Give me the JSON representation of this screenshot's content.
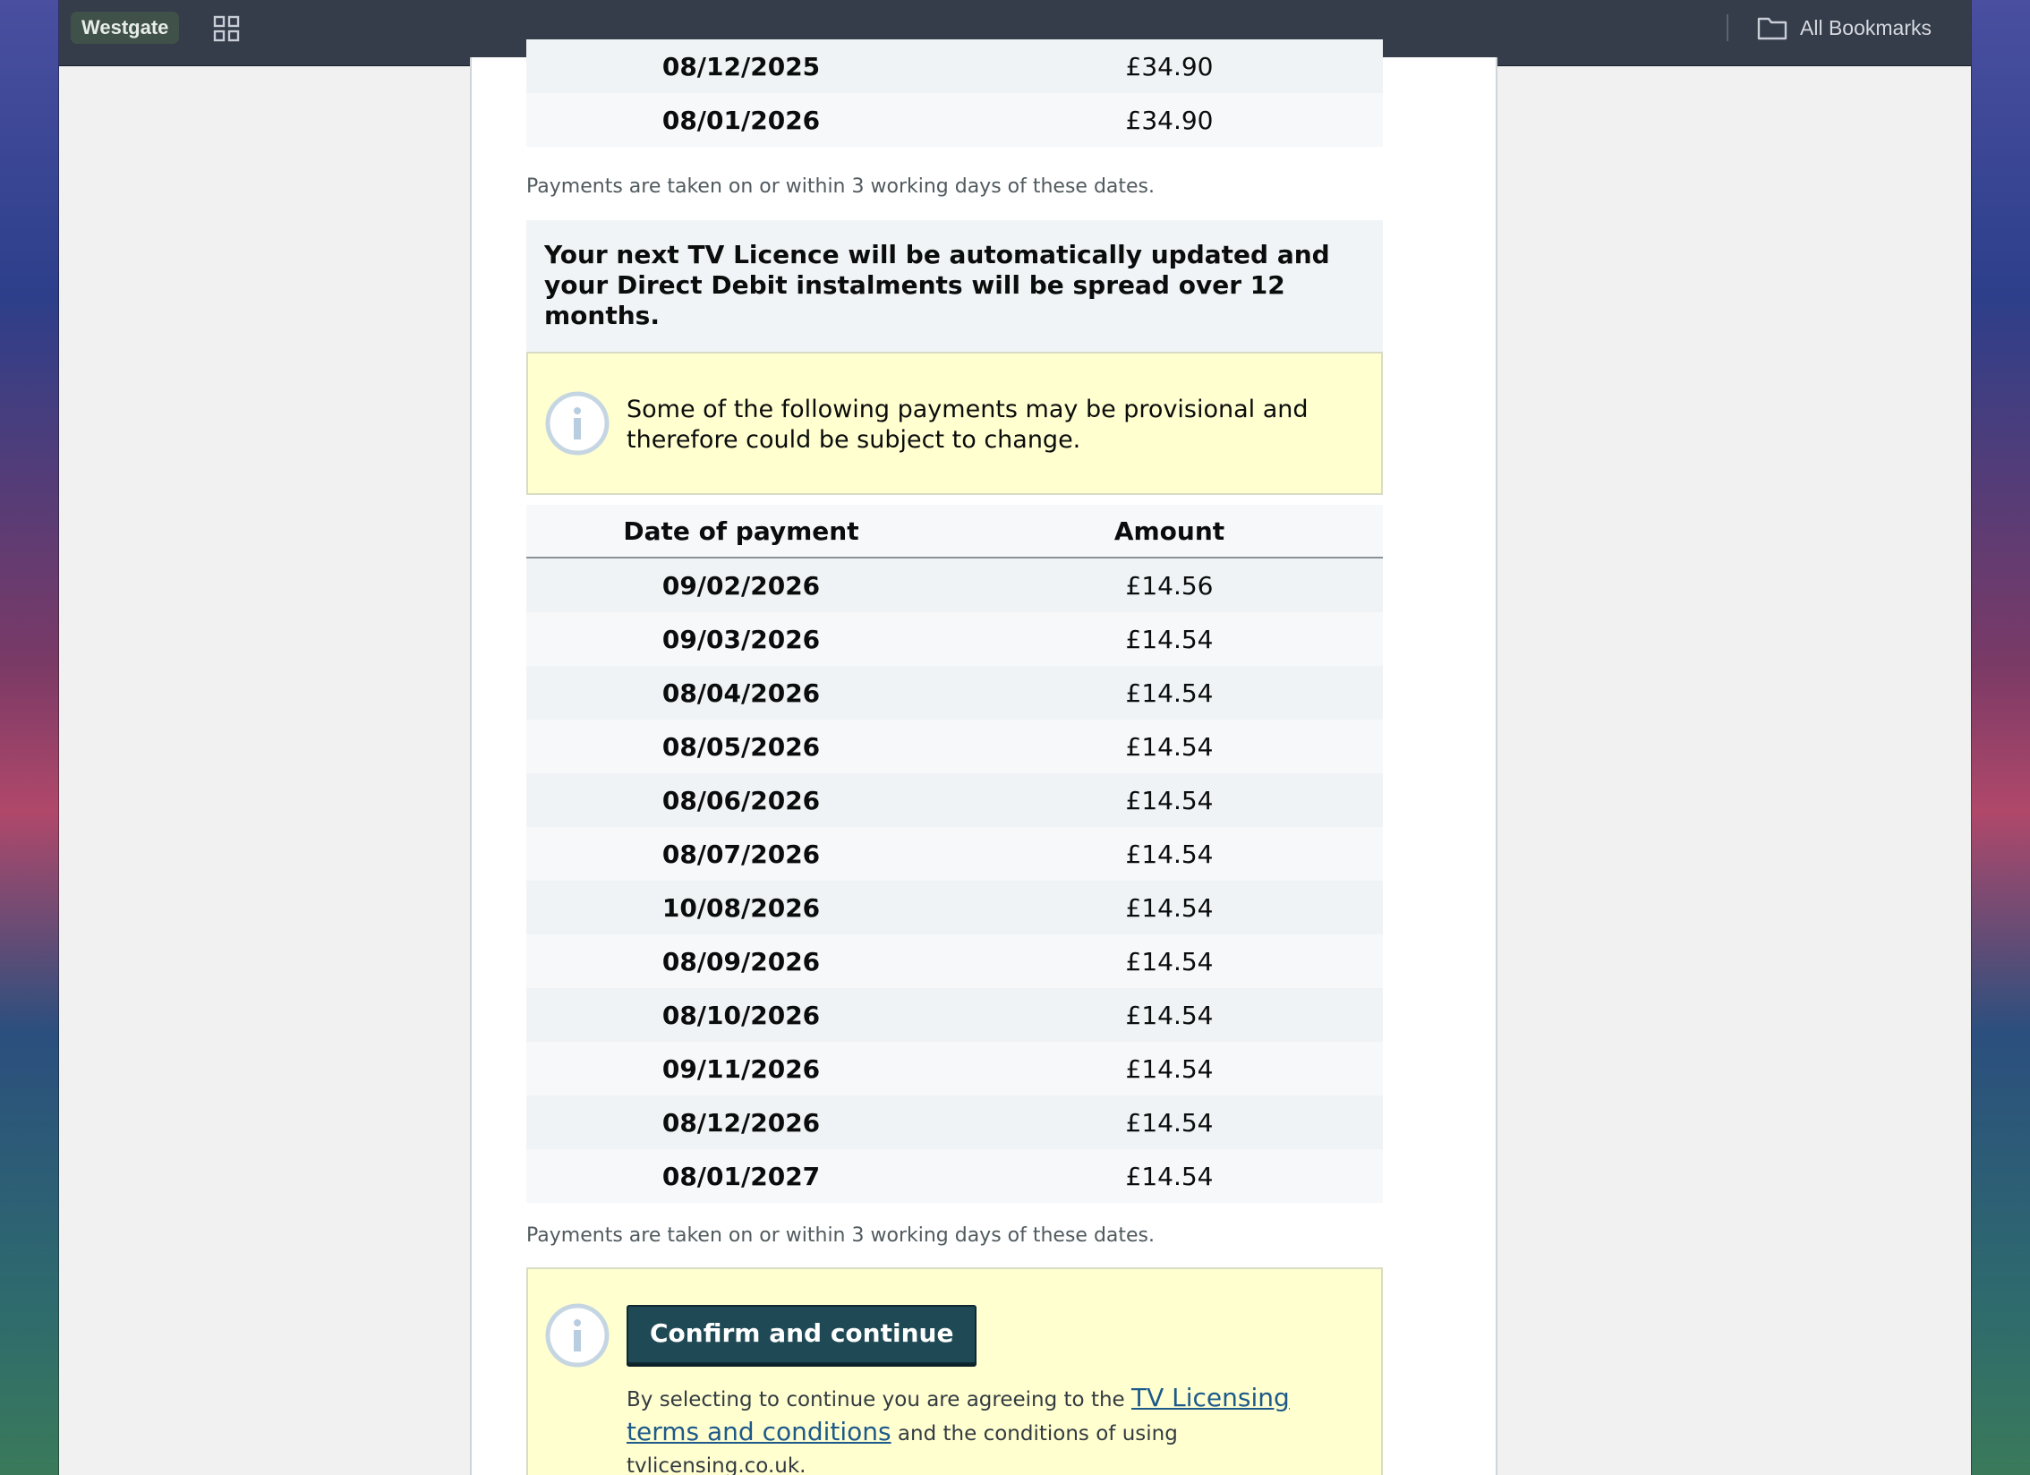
{
  "browser": {
    "profile_label": "Westgate",
    "bookmarks_label": "All Bookmarks"
  },
  "first_table": {
    "rows": [
      {
        "date": "08/12/2025",
        "amount": "£34.90"
      },
      {
        "date": "08/01/2026",
        "amount": "£34.90"
      }
    ]
  },
  "payment_note_1": "Payments are taken on or within 3 working days of these dates.",
  "next_licence_notice": "Your next TV Licence will be automatically updated and your Direct Debit instalments will be spread over 12 months.",
  "provisional_notice": "Some of the following payments may be provisional and therefore could be subject to change.",
  "second_table": {
    "headers": {
      "date": "Date of payment",
      "amount": "Amount"
    },
    "rows": [
      {
        "date": "09/02/2026",
        "amount": "£14.56"
      },
      {
        "date": "09/03/2026",
        "amount": "£14.54"
      },
      {
        "date": "08/04/2026",
        "amount": "£14.54"
      },
      {
        "date": "08/05/2026",
        "amount": "£14.54"
      },
      {
        "date": "08/06/2026",
        "amount": "£14.54"
      },
      {
        "date": "08/07/2026",
        "amount": "£14.54"
      },
      {
        "date": "10/08/2026",
        "amount": "£14.54"
      },
      {
        "date": "08/09/2026",
        "amount": "£14.54"
      },
      {
        "date": "08/10/2026",
        "amount": "£14.54"
      },
      {
        "date": "09/11/2026",
        "amount": "£14.54"
      },
      {
        "date": "08/12/2026",
        "amount": "£14.54"
      },
      {
        "date": "08/01/2027",
        "amount": "£14.54"
      }
    ]
  },
  "payment_note_2": "Payments are taken on or within 3 working days of these dates.",
  "confirm_button_label": "Confirm and continue",
  "legal": {
    "prefix": "By selecting to continue you are agreeing to the ",
    "link_text": "TV Licensing terms and conditions",
    "suffix": " and the conditions of using tvlicensing.co.uk."
  },
  "icons": {
    "info": "info-circle-icon",
    "apps": "apps-grid-icon",
    "folder": "folder-icon"
  }
}
